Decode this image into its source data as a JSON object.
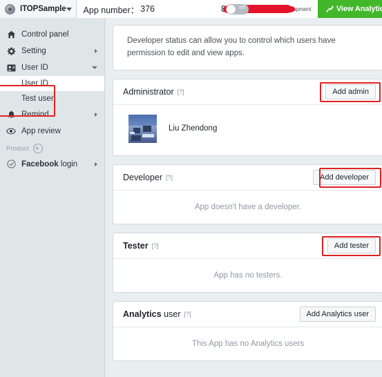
{
  "topbar": {
    "app_logo_icon": "app-circle-icon",
    "app_name": "ITOPSample",
    "dropdown_icon": "chevron-down-icon",
    "app_number_label": "App number：",
    "app_number_value": "376",
    "app_number_redacted_suffix": "8",
    "toggle_state_label": "off",
    "status_text": "Status: in development",
    "analytics_button": "View Analytics",
    "analytics_icon": "trend-arrow-icon"
  },
  "sidebar": {
    "items": [
      {
        "label": "Control panel",
        "icon": "home-icon",
        "caret": "none"
      },
      {
        "label": "Setting",
        "icon": "gear-icon",
        "caret": "right"
      },
      {
        "label": "User ID",
        "icon": "id-card-icon",
        "caret": "down"
      }
    ],
    "sub_items": [
      {
        "label": "User ID",
        "active": true
      },
      {
        "label": "Test user",
        "active": false
      }
    ],
    "items_after": [
      {
        "label": "Remind",
        "icon": "bell-icon",
        "caret": "right"
      },
      {
        "label": "App review",
        "icon": "eye-icon",
        "caret": "none"
      }
    ],
    "product_label": "Product",
    "product_add_icon": "plus-circle-icon",
    "product_items": [
      {
        "label_bold": "Facebook",
        "label_rest": "login",
        "icon": "check-circle-icon",
        "caret": "right"
      }
    ]
  },
  "main": {
    "notice": "Developer status can allow you to control which users have permission to edit and view apps.",
    "sections": [
      {
        "title": "Administrator",
        "title_bold_part": "",
        "help_marker": "[?]",
        "button": "Add admin",
        "button_highlighted": true,
        "empty_text": "",
        "members": [
          {
            "name": "Liu Zhendong",
            "avatar": "snowy-village-photo"
          }
        ]
      },
      {
        "title": "Developer",
        "title_bold_part": "",
        "help_marker": "[?]",
        "button": "Add developer",
        "button_highlighted": true,
        "empty_text": "App doesn't have a developer.",
        "members": []
      },
      {
        "title": "Tester",
        "title_bold_part": "",
        "help_marker": "[?]",
        "button": "Add tester",
        "button_highlighted": true,
        "empty_text": "App has no testers.",
        "members": []
      },
      {
        "title": "Analytics",
        "title_rest": " user",
        "help_marker": "[?]",
        "button": "Add Analytics user",
        "button_highlighted": false,
        "empty_text": "This App has no Analytics users",
        "members": []
      }
    ]
  },
  "colors": {
    "accent_green": "#42b72a",
    "highlight_red": "#e02020",
    "redaction_red": "#e3142a",
    "sidebar_bg": "#dfe6e8",
    "content_bg": "#e9eef0"
  }
}
